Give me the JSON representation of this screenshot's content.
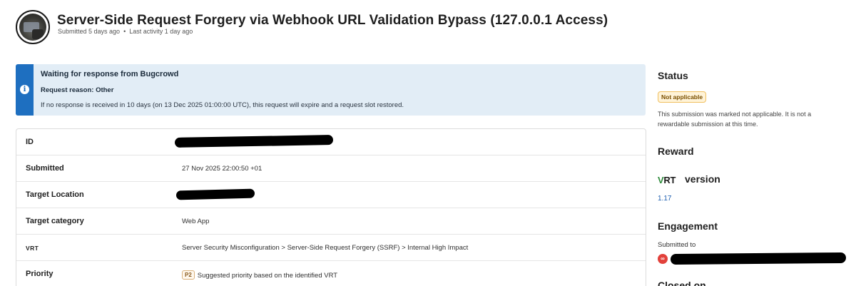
{
  "header": {
    "title": "Server-Side Request Forgery via Webhook URL Validation Bypass (127.0.0.1 Access)",
    "submitted": "Submitted 5 days ago",
    "separator": "•",
    "last_activity": "Last activity 1 day ago"
  },
  "notice": {
    "icon": "info-icon",
    "title": "Waiting for response from Bugcrowd",
    "reason": "Request reason: Other",
    "text": "If no response is received in 10 days (on 13 Dec 2025 01:00:00 UTC), this request will expire and a request slot restored.",
    "accent_color": "#1e6fc0",
    "background_color": "#e2edf6"
  },
  "details": {
    "rows": [
      {
        "label": "ID",
        "value": ""
      },
      {
        "label": "Submitted",
        "value": "27 Nov 2025 22:00:50 +01"
      },
      {
        "label": "Target Location",
        "value": ""
      },
      {
        "label": "Target category",
        "value": "Web App"
      },
      {
        "label": "VRT",
        "value": "Server Security Misconfiguration > Server-Side Request Forgery (SSRF) > Internal High Impact"
      },
      {
        "label": "Priority",
        "badge": "P2",
        "value": "Suggested priority based on the identified VRT"
      }
    ]
  },
  "sidebar": {
    "status_heading": "Status",
    "status_badge": "Not applicable",
    "status_description": "This submission was marked not applicable. It is not a rewardable submission at this time.",
    "reward_heading": "Reward",
    "vrt_logo_v": "V",
    "vrt_logo_rt": "RT",
    "vrt_heading": "version",
    "vrt_version": "1.17",
    "engagement_heading": "Engagement",
    "submitted_to": "Submitted to",
    "engagement_icon": "bugcrowd-logo-icon",
    "next_heading": "Closed on"
  },
  "colors": {
    "status_badge_bg": "#fff3d8",
    "link": "#1e5fb0",
    "vrt_green": "#2e8b3a",
    "engagement_red": "#e2413b"
  }
}
